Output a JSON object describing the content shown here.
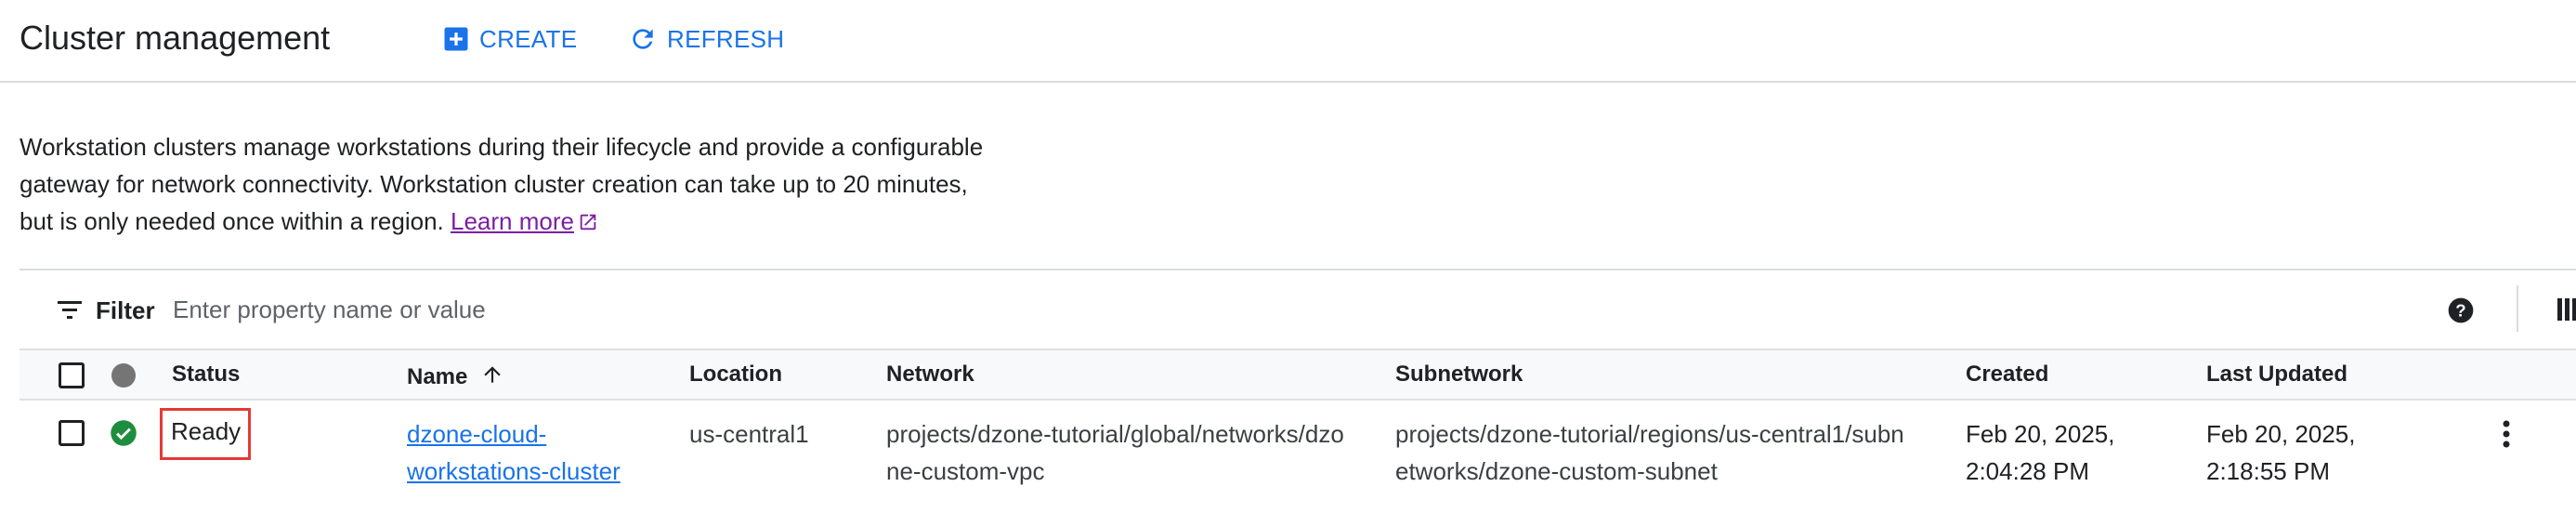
{
  "header": {
    "title": "Cluster management",
    "create_label": "CREATE",
    "refresh_label": "REFRESH"
  },
  "description": {
    "text": "Workstation clusters manage workstations during their lifecycle and provide a configurable gateway for network connectivity. Workstation cluster creation can take up to 20 minutes, but is only needed once within a region.",
    "link_label": "Learn more"
  },
  "filter": {
    "label": "Filter",
    "placeholder": "Enter property name or value"
  },
  "table": {
    "columns": {
      "status": "Status",
      "name": "Name",
      "location": "Location",
      "network": "Network",
      "subnetwork": "Subnetwork",
      "created": "Created",
      "last_updated": "Last Updated"
    },
    "rows": [
      {
        "status": "Ready",
        "name": "dzone-cloud-workstations-cluster",
        "location": "us-central1",
        "network": "projects/dzone-tutorial/global/networks/dzone-custom-vpc",
        "subnetwork": "projects/dzone-tutorial/regions/us-central1/subnetworks/dzone-custom-subnet",
        "created": "Feb 20, 2025, 2:04:28 PM",
        "last_updated": "Feb 20, 2025, 2:18:55 PM"
      }
    ]
  },
  "colors": {
    "accent": "#1a73e8",
    "link_visited": "#7b1fa2",
    "ok_green": "#1e8e3e",
    "highlight_red": "#e53935"
  },
  "icons": {
    "create": "add-box-icon",
    "refresh": "refresh-icon",
    "external_link": "external-link-icon",
    "filter": "filter-list-icon",
    "help": "help-icon",
    "columns": "column-display-icon",
    "status_ok": "check-circle-icon",
    "sort": "arrow-up-icon",
    "row_menu": "more-vert-icon"
  }
}
